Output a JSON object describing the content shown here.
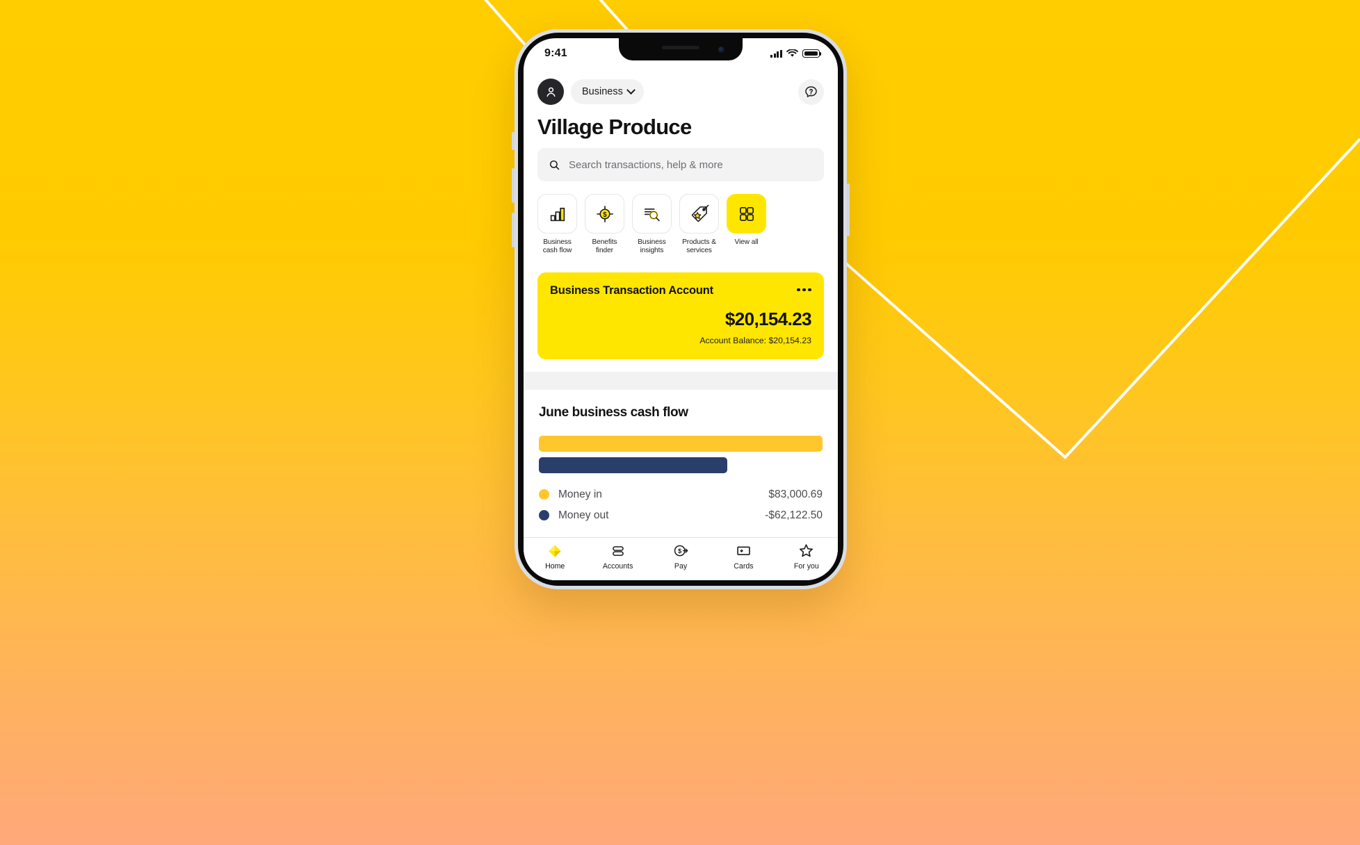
{
  "background": {
    "gradient_top": "#FFCD00",
    "gradient_bottom": "#FFA87A",
    "line_color": "#FFFFFF"
  },
  "status_bar": {
    "time": "9:41",
    "cellular_icon": "signal-bars-icon",
    "wifi_icon": "wifi-icon",
    "battery_icon": "battery-full-icon"
  },
  "top_bar": {
    "avatar_icon": "person-avatar-icon",
    "profile_label": "Business",
    "profile_chevron_icon": "chevron-down-icon",
    "help_icon": "help-chat-icon"
  },
  "page_title": "Village Produce",
  "search": {
    "icon": "search-icon",
    "placeholder": "Search transactions, help & more"
  },
  "quick_actions": [
    {
      "label": "Business\ncash flow",
      "label_line1": "Business",
      "label_line2": "cash flow",
      "icon": "bar-chart-icon",
      "accent": false
    },
    {
      "label": "Benefits\nfinder",
      "label_line1": "Benefits",
      "label_line2": "finder",
      "icon": "dollar-target-icon",
      "accent": false
    },
    {
      "label": "Business\ninsights",
      "label_line1": "Business",
      "label_line2": "insights",
      "icon": "magnifier-insights-icon",
      "accent": false
    },
    {
      "label": "Products &\nservices",
      "label_line1": "Products &",
      "label_line2": "services",
      "icon": "price-tag-star-icon",
      "accent": false
    },
    {
      "label": "View all",
      "label_line1": "View all",
      "label_line2": "",
      "icon": "grid-squares-icon",
      "accent": true
    }
  ],
  "account_card": {
    "name": "Business Transaction Account",
    "menu_icon": "more-options-icon",
    "amount": "$20,154.23",
    "subtitle": "Account Balance: $20,154.23",
    "card_color": "#FFE600"
  },
  "cash_flow": {
    "title": "June business cash flow",
    "legend": [
      {
        "label": "Money in",
        "value": "$83,000.69",
        "color": "#FFC72C"
      },
      {
        "label": "Money out",
        "value": "-$62,122.50",
        "color": "#2A3E6B"
      }
    ]
  },
  "chart_data": {
    "type": "bar",
    "title": "June business cash flow",
    "orientation": "horizontal",
    "categories": [
      "Money in",
      "Money out"
    ],
    "values": [
      83000.69,
      -62122.5
    ],
    "display_values": [
      "$83,000.69",
      "-$62,122.50"
    ],
    "bar_fractions": [
      1.0,
      0.665
    ],
    "colors": [
      "#FFC72C",
      "#2A3E6B"
    ],
    "xlabel": "",
    "ylabel": "",
    "grid": false,
    "legend_position": "below"
  },
  "tab_bar": [
    {
      "label": "Home",
      "icon": "diamond-home-icon",
      "active": true
    },
    {
      "label": "Accounts",
      "icon": "accounts-stack-icon",
      "active": false
    },
    {
      "label": "Pay",
      "icon": "pay-dollar-arrow-icon",
      "active": false
    },
    {
      "label": "Cards",
      "icon": "card-icon",
      "active": false
    },
    {
      "label": "For you",
      "icon": "star-icon",
      "active": false
    }
  ]
}
